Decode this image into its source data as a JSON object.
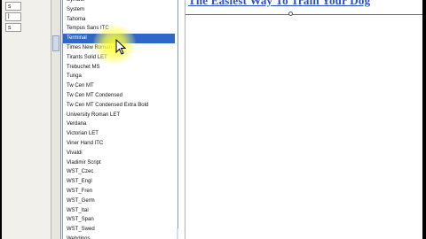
{
  "left_panel": {
    "rows": [
      "s",
      "l",
      "s"
    ]
  },
  "font_list": {
    "items": [
      "Symbol",
      "System",
      "Tahoma",
      "Tempus Sans ITC",
      "Terminal",
      "Times New Roman",
      "Tirants Solid LET",
      "Trebuchet MS",
      "Tunga",
      "Tw Cen MT",
      "Tw Cen MT Condensed",
      "Tw Cen MT Condensed Extra Bold",
      "University Roman LET",
      "Verdana",
      "Victorian LET",
      "Viner Hand ITC",
      "Vivaldi",
      "Vladimir Script",
      "WST_Czec",
      "WST_Engl",
      "WST_Fren",
      "WST_Germ",
      "WST_Ital",
      "WST_Span",
      "WST_Swed",
      "Webdings"
    ],
    "selected_index": 4
  },
  "editor": {
    "title": "The Easiest Way To Train Your Dog"
  },
  "colors": {
    "selection": "#3066c8",
    "title_text": "#2d4cc9",
    "highlight": "#ffff40"
  },
  "icons": {
    "cursor": "mouse-pointer-icon"
  }
}
